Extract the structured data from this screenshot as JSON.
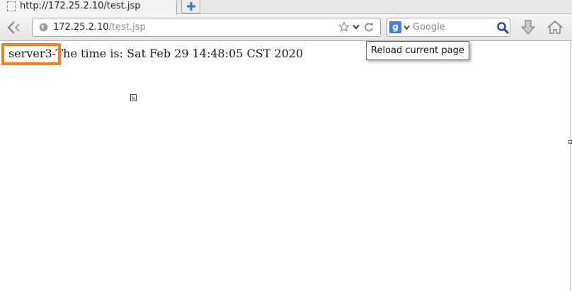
{
  "tab": {
    "title": "http://172.25.2.10/test.jsp",
    "new_tab_icon": "plus-icon"
  },
  "toolbar": {
    "back_icon": "back-arrow-icon",
    "url_host": "172.25.2.10",
    "url_path": "/test.jsp",
    "site_icon": "globe-icon",
    "bookmark_icon": "star-icon",
    "history_dropdown_icon": "chevron-down-icon",
    "reload_icon": "reload-icon",
    "download_icon": "download-arrow-icon",
    "home_icon": "home-icon"
  },
  "search": {
    "engine_letter": "g",
    "placeholder": "Google",
    "engine_icon": "google-icon",
    "search_icon": "magnifier-icon"
  },
  "tooltip": {
    "text": "Reload current page"
  },
  "page": {
    "server": "server3",
    "message": "-The time is: Sat Feb 29 14:48:05 CST 2020",
    "broken_image_icon": "broken-image-icon"
  },
  "colors": {
    "highlight": "#f28020",
    "engine": "#4a7dd9"
  }
}
